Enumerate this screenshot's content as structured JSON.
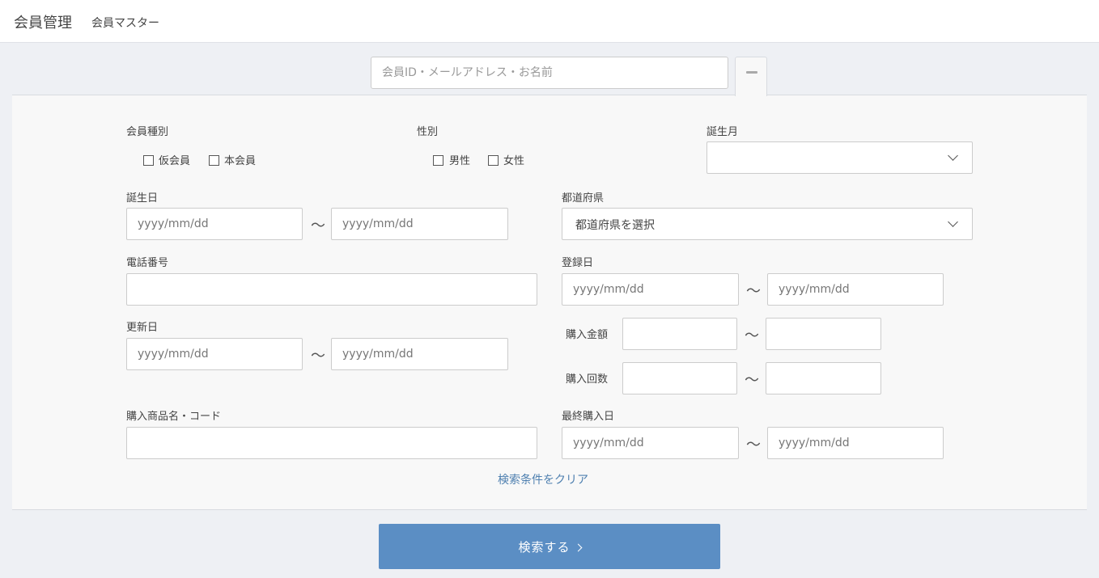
{
  "header": {
    "title": "会員管理",
    "subtitle": "会員マスター"
  },
  "search": {
    "placeholder": "会員ID・メールアドレス・お名前"
  },
  "form": {
    "member_type": {
      "label": "会員種別",
      "options": [
        "仮会員",
        "本会員"
      ]
    },
    "gender": {
      "label": "性別",
      "options": [
        "男性",
        "女性"
      ]
    },
    "birth_month": {
      "label": "誕生月",
      "value": ""
    },
    "birthday": {
      "label": "誕生日",
      "from_placeholder": "yyyy/mm/dd",
      "to_placeholder": "yyyy/mm/dd"
    },
    "prefecture": {
      "label": "都道府県",
      "value": "都道府県を選択"
    },
    "phone": {
      "label": "電話番号",
      "value": ""
    },
    "registered": {
      "label": "登録日",
      "from_placeholder": "yyyy/mm/dd",
      "to_placeholder": "yyyy/mm/dd"
    },
    "updated": {
      "label": "更新日",
      "from_placeholder": "yyyy/mm/dd",
      "to_placeholder": "yyyy/mm/dd"
    },
    "purchase_amount": {
      "label": "購入金額"
    },
    "purchase_count": {
      "label": "購入回数"
    },
    "product": {
      "label": "購入商品名・コード",
      "value": ""
    },
    "last_purchase": {
      "label": "最終購入日",
      "from_placeholder": "yyyy/mm/dd",
      "to_placeholder": "yyyy/mm/dd"
    },
    "range_separator": "〜"
  },
  "actions": {
    "clear_label": "検索条件をクリア",
    "search_label": "検索する"
  },
  "colors": {
    "primary": "#5b8ec4",
    "link": "#4f80b0",
    "background": "#eef0f4",
    "panel": "#f8f8f8"
  }
}
